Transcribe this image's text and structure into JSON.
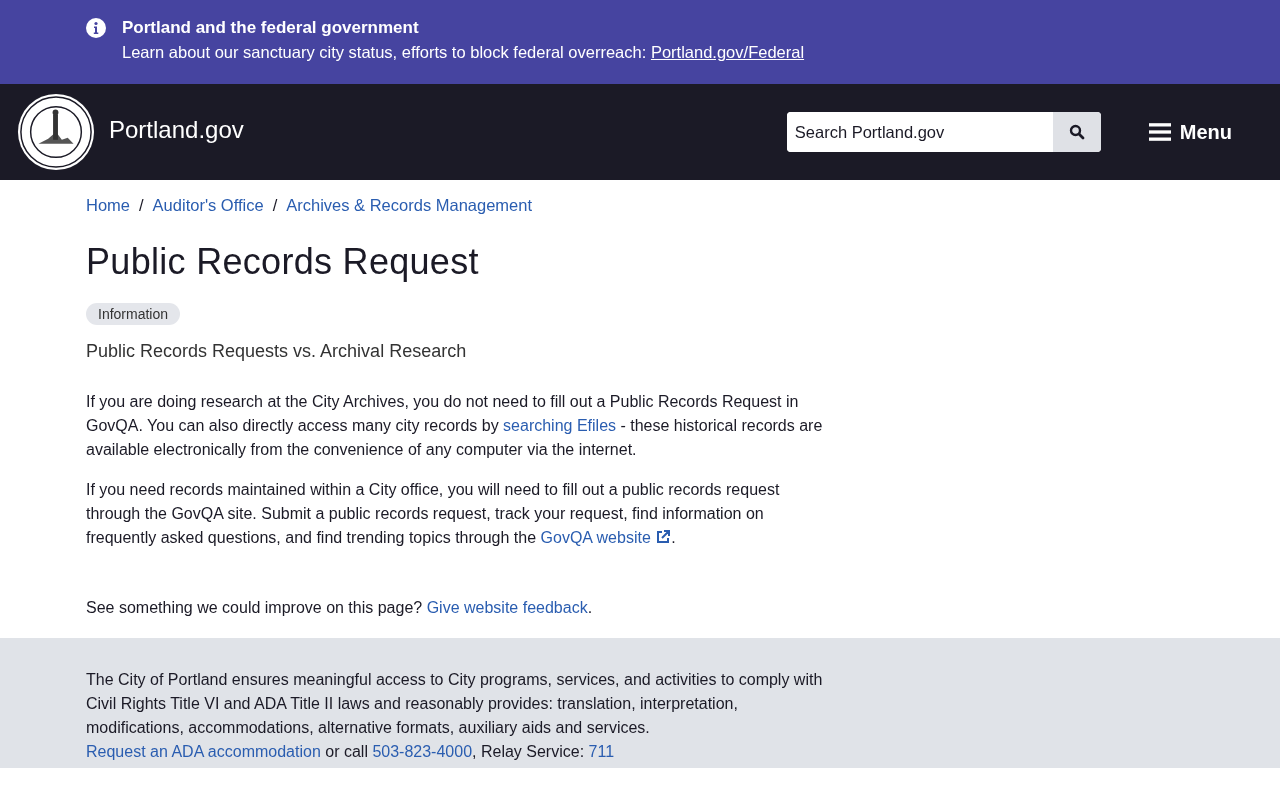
{
  "alert_banner": {
    "title": "Portland and the federal government",
    "text": "Learn about our sanctuary city status, efforts to block federal overreach:",
    "link": "Portland.gov/Federal"
  },
  "header": {
    "site_name": "Portland.gov",
    "search": {
      "placeholder": "Search Portland.gov"
    },
    "menu_button": "Menu"
  },
  "breadcrumbs": [
    {
      "label": "Home"
    },
    {
      "label": "Auditor's Office"
    },
    {
      "label": "Archives & Records Management"
    }
  ],
  "breadcrumb_separator": "/",
  "page": {
    "title": "Public Records Request",
    "tag": "Information",
    "subtitle": "Public Records Requests vs. Archival Research",
    "paragraphs": [
      [
        {
          "kind": "text",
          "text": "If you are doing research at the City Archives, you do not need to fill out a Public Records Request in GovQA. You can also directly access many city records by "
        },
        {
          "kind": "link",
          "text": "searching Efiles"
        },
        {
          "kind": "text",
          "text": " - these historical records are available electronically from the convenience of any computer via the internet."
        }
      ],
      [
        {
          "kind": "text",
          "text": "If you need records maintained within a City office, you will need to fill out a public records request through the GovQA site. Submit a public records request, track your request, find information on frequently asked questions, and find trending topics through the "
        },
        {
          "kind": "external_link",
          "text": "GovQA website"
        },
        {
          "kind": "text",
          "text": "."
        }
      ]
    ],
    "feedback": [
      {
        "kind": "text",
        "text": "See something we could improve on this page? "
      },
      {
        "kind": "link",
        "text": "Give website feedback"
      },
      {
        "kind": "text",
        "text": "."
      }
    ]
  },
  "footer": {
    "notice": [
      {
        "kind": "text",
        "text": "The City of Portland ensures meaningful access to City programs, services, and activities to comply with Civil Rights Title VI and ADA Title II laws and reasonably provides: translation, interpretation, modifications, accommodations, alternative formats, auxiliary aids and services. "
      },
      {
        "kind": "link",
        "text": "Request an ADA accommodation"
      },
      {
        "kind": "text",
        "text": " or call "
      },
      {
        "kind": "link",
        "text": "503-823-4000"
      },
      {
        "kind": "text",
        "text": ", Relay Service: "
      },
      {
        "kind": "link",
        "text": "711"
      }
    ]
  }
}
